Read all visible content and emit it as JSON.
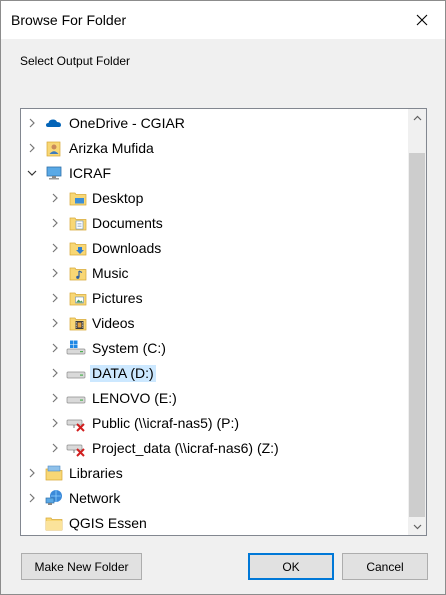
{
  "window": {
    "title": "Browse For Folder"
  },
  "instruction": "Select Output Folder",
  "tree": {
    "items": [
      {
        "label": "OneDrive - CGIAR",
        "icon": "onedrive-cloud-icon",
        "expanded": false
      },
      {
        "label": "Arizka Mufida",
        "icon": "user-folder-icon",
        "expanded": false
      },
      {
        "label": "ICRAF",
        "icon": "this-pc-icon",
        "expanded": true
      },
      {
        "label": "Desktop",
        "icon": "desktop-folder-icon",
        "expanded": false
      },
      {
        "label": "Documents",
        "icon": "documents-folder-icon",
        "expanded": false
      },
      {
        "label": "Downloads",
        "icon": "downloads-folder-icon",
        "expanded": false
      },
      {
        "label": "Music",
        "icon": "music-folder-icon",
        "expanded": false
      },
      {
        "label": "Pictures",
        "icon": "pictures-folder-icon",
        "expanded": false
      },
      {
        "label": "Videos",
        "icon": "videos-folder-icon",
        "expanded": false
      },
      {
        "label": "System (C:)",
        "icon": "system-drive-icon",
        "expanded": false
      },
      {
        "label": "DATA (D:)",
        "icon": "drive-icon",
        "expanded": false,
        "selected": true
      },
      {
        "label": "LENOVO (E:)",
        "icon": "drive-icon",
        "expanded": false
      },
      {
        "label": "Public (\\\\icraf-nas5) (P:)",
        "icon": "disconnected-network-drive-icon",
        "expanded": false
      },
      {
        "label": "Project_data (\\\\icraf-nas6) (Z:)",
        "icon": "disconnected-network-drive-icon",
        "expanded": false
      },
      {
        "label": "Libraries",
        "icon": "libraries-icon",
        "expanded": false
      },
      {
        "label": "Network",
        "icon": "network-icon",
        "expanded": false
      },
      {
        "label": "QGIS Essen",
        "icon": "folder-icon",
        "expanded": false
      }
    ]
  },
  "buttons": {
    "new_folder": "Make New Folder",
    "ok": "OK",
    "cancel": "Cancel"
  },
  "colors": {
    "selection": "#cce8ff",
    "default_button_border": "#0078d7",
    "folder_yellow": "#f8d775"
  }
}
